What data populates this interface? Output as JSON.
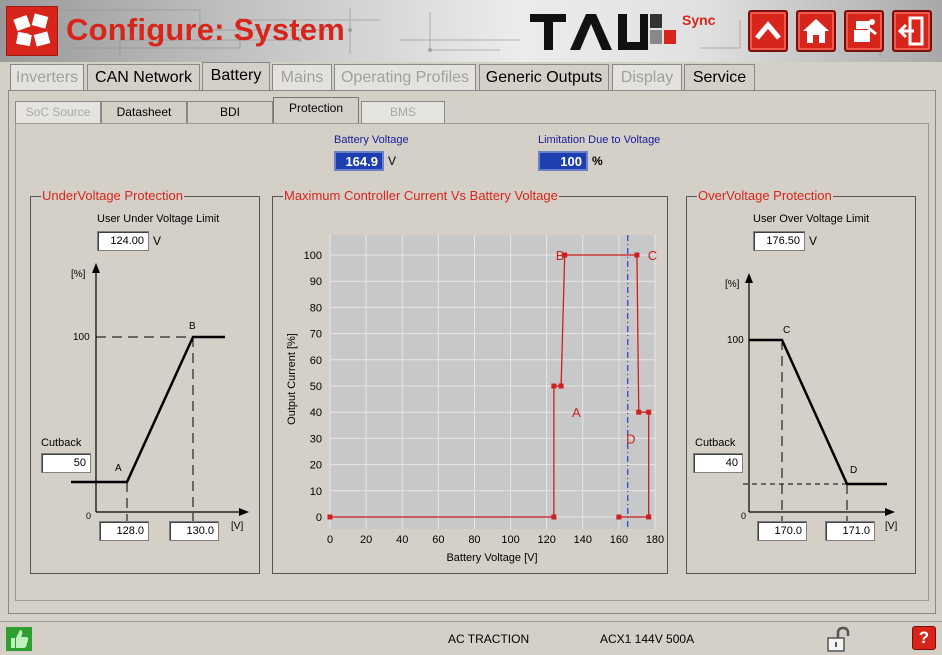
{
  "header": {
    "title": "Configure: System",
    "brand": "TAU",
    "brand_sync": "Sync",
    "buttons": [
      "up-icon",
      "home-icon",
      "operator-icon",
      "exit-icon"
    ]
  },
  "main_tabs": [
    {
      "label": "Inverters",
      "state": "disabled"
    },
    {
      "label": "CAN Network",
      "state": "enabled"
    },
    {
      "label": "Battery",
      "state": "active"
    },
    {
      "label": "Mains",
      "state": "disabled"
    },
    {
      "label": "Operating Profiles",
      "state": "disabled"
    },
    {
      "label": "Generic Outputs",
      "state": "enabled"
    },
    {
      "label": "Display",
      "state": "disabled"
    },
    {
      "label": "Service",
      "state": "enabled"
    }
  ],
  "sub_tabs": [
    {
      "label": "SoC Source",
      "state": "disabled"
    },
    {
      "label": "Datasheet",
      "state": "enabled"
    },
    {
      "label": "BDI",
      "state": "enabled"
    },
    {
      "label": "Protection",
      "state": "active"
    },
    {
      "label": "BMS",
      "state": "disabled"
    }
  ],
  "readouts": {
    "battery_voltage_label": "Battery Voltage",
    "battery_voltage_value": "164.9",
    "battery_voltage_unit": "V",
    "limitation_label": "Limitation Due to Voltage",
    "limitation_value": "100",
    "limitation_unit": "%"
  },
  "undervoltage": {
    "title": "UnderVoltage Protection",
    "limit_label": "User Under Voltage Limit",
    "limit_value": "124.00",
    "limit_unit": "V",
    "y_unit": "[%]",
    "x_unit": "[V]",
    "y_100": "100",
    "zero": "0",
    "cutback_label": "Cutback",
    "cutback_value": "50",
    "point_a": "A",
    "point_b": "B",
    "x_a_value": "128.0",
    "x_b_value": "130.0"
  },
  "overvoltage": {
    "title": "OverVoltage Protection",
    "limit_label": "User Over Voltage Limit",
    "limit_value": "176.50",
    "limit_unit": "V",
    "y_unit": "[%]",
    "x_unit": "[V]",
    "y_100": "100",
    "zero": "0",
    "cutback_label": "Cutback",
    "cutback_value": "40",
    "point_c": "C",
    "point_d": "D",
    "x_c_value": "170.0",
    "x_d_value": "171.0"
  },
  "chart_data": {
    "type": "line",
    "title": "Maximum Controller Current Vs Battery Voltage",
    "xlabel": "Battery Voltage [V]",
    "ylabel": "Output Current [%]",
    "xlim": [
      0,
      180
    ],
    "ylim": [
      0,
      100
    ],
    "xticks": [
      0,
      20,
      40,
      60,
      80,
      100,
      120,
      140,
      160,
      180
    ],
    "yticks": [
      0,
      10,
      20,
      30,
      40,
      50,
      60,
      70,
      80,
      90,
      100
    ],
    "grid": true,
    "series": [
      {
        "color": "#cc1f1f",
        "x": [
          0,
          124,
          124,
          128,
          130,
          170,
          171,
          176.5,
          176.5,
          160
        ],
        "y": [
          0,
          0,
          50,
          50,
          100,
          100,
          40,
          40,
          0,
          0
        ]
      }
    ],
    "markers": [
      [
        0,
        0
      ],
      [
        124,
        0
      ],
      [
        124,
        50
      ],
      [
        128,
        50
      ],
      [
        130,
        100
      ],
      [
        170,
        100
      ],
      [
        171,
        40
      ],
      [
        176.5,
        40
      ],
      [
        176.5,
        0
      ],
      [
        160,
        0
      ]
    ],
    "annotations": [
      {
        "text": "A",
        "x": 134,
        "y": 40
      },
      {
        "text": "B",
        "x": 125,
        "y": 100
      },
      {
        "text": "C",
        "x": 176,
        "y": 100
      },
      {
        "text": "D",
        "x": 164,
        "y": 30
      }
    ],
    "vline": {
      "x": 164.9,
      "color": "#2a3fc8",
      "style": "dash-dot"
    }
  },
  "status": {
    "vehicle": "AC TRACTION",
    "controller": "ACX1 144V 500A"
  }
}
